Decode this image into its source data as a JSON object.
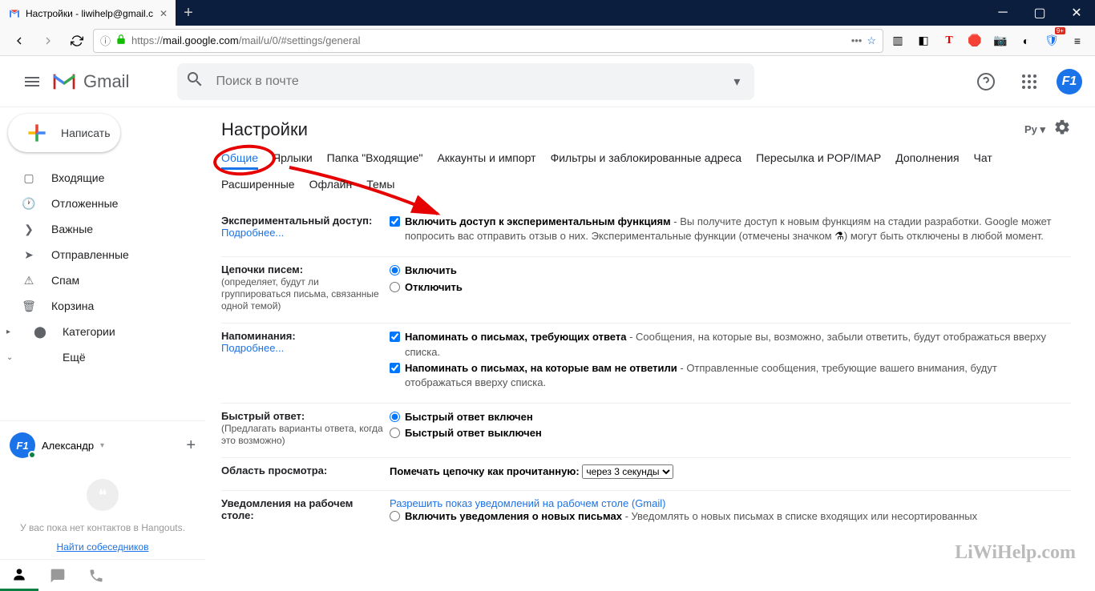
{
  "browser": {
    "tab_title": "Настройки - liwihelp@gmail.c",
    "url_prefix": "https://",
    "url_domain": "mail.google.com",
    "url_path": "/mail/u/0/#settings/general"
  },
  "header": {
    "logo_text": "Gmail",
    "search_placeholder": "Поиск в почте",
    "avatar_initial": "F1"
  },
  "sidebar": {
    "compose": "Написать",
    "items": [
      {
        "icon": "inbox",
        "label": "Входящие"
      },
      {
        "icon": "clock",
        "label": "Отложенные"
      },
      {
        "icon": "star",
        "label": "Важные"
      },
      {
        "icon": "send",
        "label": "Отправленные"
      },
      {
        "icon": "spam",
        "label": "Спам"
      },
      {
        "icon": "trash",
        "label": "Корзина"
      },
      {
        "icon": "label",
        "label": "Категории",
        "arrow": true
      },
      {
        "icon": "more",
        "label": "Ещё",
        "arrow_down": true
      }
    ]
  },
  "hangouts": {
    "user": "Александр",
    "empty_text": "У вас пока нет контактов в Hangouts.",
    "find_link": "Найти собеседников"
  },
  "settings": {
    "title": "Настройки",
    "density": "Pу",
    "tabs_row1": [
      "Общие",
      "Ярлыки",
      "Папка \"Входящие\"",
      "Аккаунты и импорт",
      "Фильтры и заблокированные адреса",
      "Пересылка и POP/IMAP",
      "Дополнения",
      "Чат"
    ],
    "tabs_row2": [
      "Расширенные",
      "Офлайн",
      "Темы"
    ],
    "rows": {
      "experimental": {
        "label": "Экспериментальный доступ:",
        "more": "Подробнее...",
        "opt": "Включить доступ к экспериментальным функциям",
        "desc": " - Вы получите доступ к новым функциям на стадии разработки. Google может попросить вас отправить отзыв о них. Экспериментальные функции (отмечены значком ",
        "desc2": ") могут быть отключены в любой момент."
      },
      "threads": {
        "label": "Цепочки писем:",
        "sub": "(определяет, будут ли группироваться письма, связанные одной темой)",
        "on": "Включить",
        "off": "Отключить"
      },
      "nudges": {
        "label": "Напоминания:",
        "more": "Подробнее...",
        "opt1": "Напоминать о письмах, требующих ответа",
        "desc1": " - Сообщения, на которые вы, возможно, забыли ответить, будут отображаться вверху списка.",
        "opt2": "Напоминать о письмах, на которые вам не ответили",
        "desc2": " - Отправленные сообщения, требующие вашего внимания, будут отображаться вверху списка."
      },
      "smartreply": {
        "label": "Быстрый ответ:",
        "sub": "(Предлагать варианты ответа, когда это возможно)",
        "on": "Быстрый ответ включен",
        "off": "Быстрый ответ выключен"
      },
      "preview": {
        "label": "Область просмотра:",
        "text": "Помечать цепочку как прочитанную: ",
        "options": [
          "через 3 секунды"
        ]
      },
      "desktop": {
        "label": "Уведомления на рабочем столе:",
        "link": "Разрешить показ уведомлений на рабочем столе (Gmail)",
        "opt1": "Включить уведомления о новых письмах",
        "desc1": " - Уведомлять о новых письмах в списке входящих или несортированных"
      }
    }
  },
  "watermark": "LiWiHelp.com"
}
